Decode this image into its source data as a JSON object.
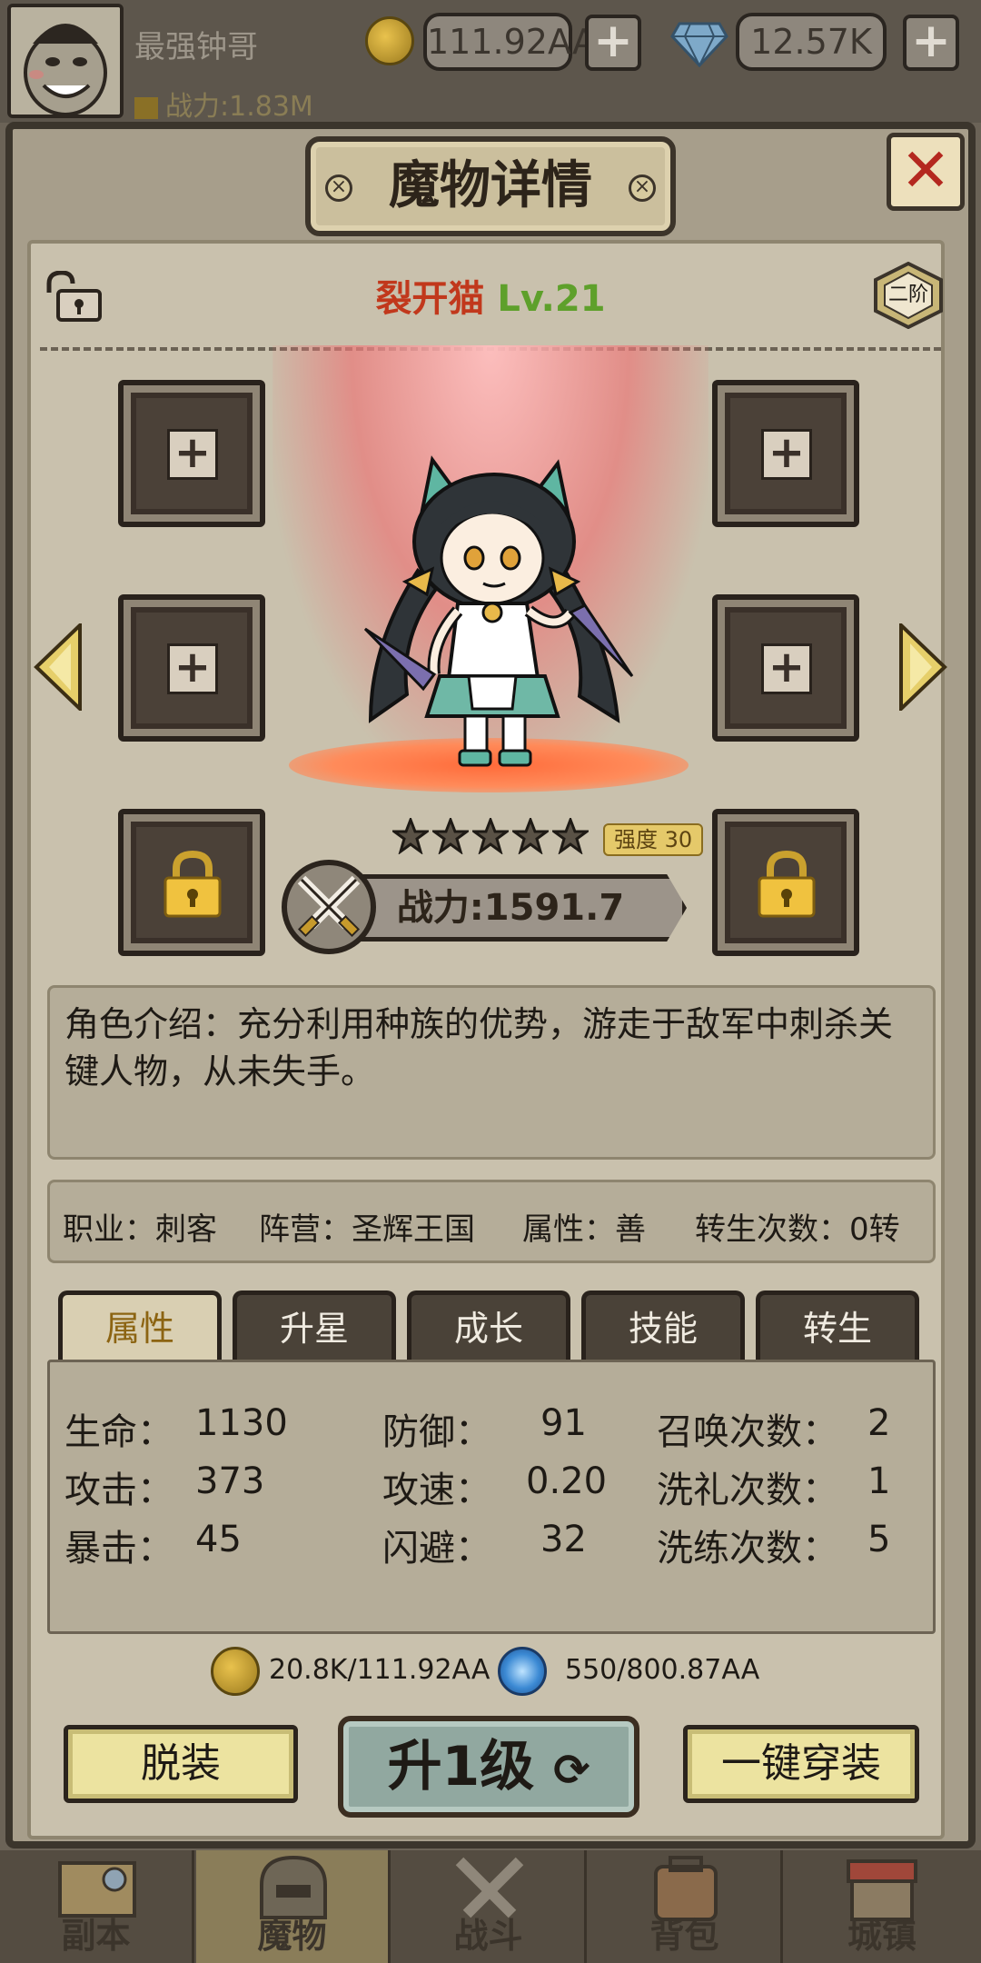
{
  "topbar": {
    "player_name": "最强钟哥",
    "combat_power": "战力:1.83M",
    "gold": "111.92AA",
    "diamonds": "12.57K",
    "plus_label": "+"
  },
  "dialog": {
    "title": "魔物详情",
    "close_label": "✕",
    "monster_name": "裂开猫",
    "monster_level": "Lv.21",
    "rank": "二阶",
    "star_count": 5,
    "strength_label": "强度",
    "strength_value": "30",
    "power": "战力:1591.7",
    "description": "角色介绍：充分利用种族的优势，游走于敌军中刺杀关键人物，从未失手。",
    "info": {
      "job": "职业：刺客",
      "faction": "阵营：圣辉王国",
      "alignment": "属性：善",
      "rebirth": "转生次数：0转"
    },
    "tabs": [
      "属性",
      "升星",
      "成长",
      "技能",
      "转生"
    ],
    "active_tab": "属性",
    "stats": {
      "hp_label": "生命：",
      "hp": "1130",
      "atk_label": "攻击：",
      "atk": "373",
      "crit_label": "暴击：",
      "crit": "45",
      "def_label": "防御：",
      "def": "91",
      "spd_label": "攻速：",
      "spd": "0.20",
      "dodge_label": "闪避：",
      "dodge": "32",
      "summon_label": "召唤次数：",
      "summon": "2",
      "baptism_label": "洗礼次数：",
      "baptism": "1",
      "refine_label": "洗练次数：",
      "refine": "5"
    },
    "cost_gold": "20.8K/111.92AA",
    "cost_essence": "550/800.87AA",
    "buttons": {
      "unequip": "脱装",
      "level_up": "升1级",
      "equip_all": "一键穿装"
    }
  },
  "nav": [
    "副本",
    "魔物",
    "战斗",
    "背包",
    "城镇"
  ],
  "nav_active": "魔物",
  "colors": {
    "name_red": "#c1381c",
    "level_green": "#5ea02b",
    "active_tab_text": "#8c6412",
    "close_red": "#b4281f"
  }
}
